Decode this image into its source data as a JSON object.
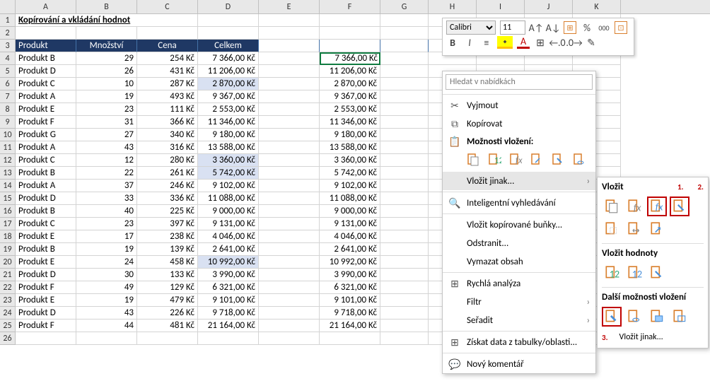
{
  "title": "Kopírování a vkládání hodnot",
  "columns": [
    "A",
    "B",
    "C",
    "D",
    "E",
    "F",
    "G",
    "H",
    "I",
    "J",
    "K"
  ],
  "headers": {
    "a": "Produkt",
    "b": "Množství",
    "c": "Cena",
    "d": "Celkem"
  },
  "mini": {
    "font": "Calibri",
    "size": "11",
    "bold": "B",
    "italic": "I",
    "percent": "%",
    "comma": "000"
  },
  "context": {
    "search_ph": "Hledat v nabídkách",
    "cut": "Vyjmout",
    "copy": "Kopírovat",
    "paste_opts": "Možnosti vložení:",
    "paste_special": "Vložit jinak...",
    "smart": "Inteligentní vyhledávání",
    "ins_copied": "Vložit kopírované buňky...",
    "delete": "Odstranit...",
    "clear": "Vymazat obsah",
    "quick": "Rychlá analýza",
    "filter": "Filtr",
    "sort": "Seřadit",
    "table_data": "Získat data z tabulky/oblasti...",
    "comment": "Nový komentář"
  },
  "sub": {
    "paste": "Vložit",
    "paste_values": "Vložit hodnoty",
    "paste_other": "Další možnosti vložení",
    "paste_special": "Vložit jinak...",
    "n1": "1.",
    "n2": "2.",
    "n3": "3."
  },
  "rows": [
    {
      "n": "4",
      "p": "Produkt B",
      "q": "29",
      "c": "254 Kč",
      "t": "7 366,00 Kč",
      "f": "7 366,00 Kč"
    },
    {
      "n": "5",
      "p": "Produkt D",
      "q": "26",
      "c": "431 Kč",
      "t": "11 206,00 Kč",
      "f": "11 206,00 Kč"
    },
    {
      "n": "6",
      "p": "Produkt C",
      "q": "10",
      "c": "287 Kč",
      "t": "2 870,00 Kč",
      "f": "2 870,00 Kč",
      "alt": 1
    },
    {
      "n": "7",
      "p": "Produkt A",
      "q": "19",
      "c": "493 Kč",
      "t": "9 367,00 Kč",
      "f": "9 367,00 Kč"
    },
    {
      "n": "8",
      "p": "Produkt E",
      "q": "23",
      "c": "111 Kč",
      "t": "2 553,00 Kč",
      "f": "2 553,00 Kč"
    },
    {
      "n": "9",
      "p": "Produkt F",
      "q": "31",
      "c": "366 Kč",
      "t": "11 346,00 Kč",
      "f": "11 346,00 Kč"
    },
    {
      "n": "10",
      "p": "Produkt G",
      "q": "27",
      "c": "340 Kč",
      "t": "9 180,00 Kč",
      "f": "9 180,00 Kč"
    },
    {
      "n": "11",
      "p": "Produkt A",
      "q": "43",
      "c": "316 Kč",
      "t": "13 588,00 Kč",
      "f": "13 588,00 Kč"
    },
    {
      "n": "12",
      "p": "Produkt C",
      "q": "12",
      "c": "280 Kč",
      "t": "3 360,00 Kč",
      "f": "3 360,00 Kč",
      "alt": 1
    },
    {
      "n": "13",
      "p": "Produkt B",
      "q": "22",
      "c": "261 Kč",
      "t": "5 742,00 Kč",
      "f": "5 742,00 Kč",
      "alt": 1
    },
    {
      "n": "14",
      "p": "Produkt A",
      "q": "37",
      "c": "246 Kč",
      "t": "9 102,00 Kč",
      "f": "9 102,00 Kč"
    },
    {
      "n": "15",
      "p": "Produkt D",
      "q": "33",
      "c": "336 Kč",
      "t": "11 088,00 Kč",
      "f": "11 088,00 Kč"
    },
    {
      "n": "16",
      "p": "Produkt B",
      "q": "40",
      "c": "225 Kč",
      "t": "9 000,00 Kč",
      "f": "9 000,00 Kč"
    },
    {
      "n": "17",
      "p": "Produkt C",
      "q": "23",
      "c": "397 Kč",
      "t": "9 131,00 Kč",
      "f": "9 131,00 Kč"
    },
    {
      "n": "18",
      "p": "Produkt E",
      "q": "17",
      "c": "238 Kč",
      "t": "4 046,00 Kč",
      "f": "4 046,00 Kč"
    },
    {
      "n": "19",
      "p": "Produkt B",
      "q": "19",
      "c": "139 Kč",
      "t": "2 641,00 Kč",
      "f": "2 641,00 Kč"
    },
    {
      "n": "20",
      "p": "Produkt E",
      "q": "24",
      "c": "458 Kč",
      "t": "10 992,00 Kč",
      "f": "10 992,00 Kč",
      "alt": 1
    },
    {
      "n": "21",
      "p": "Produkt D",
      "q": "30",
      "c": "133 Kč",
      "t": "3 990,00 Kč",
      "f": "3 990,00 Kč"
    },
    {
      "n": "22",
      "p": "Produkt F",
      "q": "49",
      "c": "129 Kč",
      "t": "6 321,00 Kč",
      "f": "6 321,00 Kč"
    },
    {
      "n": "23",
      "p": "Produkt E",
      "q": "19",
      "c": "479 Kč",
      "t": "9 101,00 Kč",
      "f": "9 101,00 Kč"
    },
    {
      "n": "24",
      "p": "Produkt D",
      "q": "43",
      "c": "226 Kč",
      "t": "9 718,00 Kč",
      "f": "9 718,00 Kč"
    },
    {
      "n": "25",
      "p": "Produkt F",
      "q": "44",
      "c": "481 Kč",
      "t": "21 164,00 Kč",
      "f": "21 164,00 Kč"
    }
  ]
}
